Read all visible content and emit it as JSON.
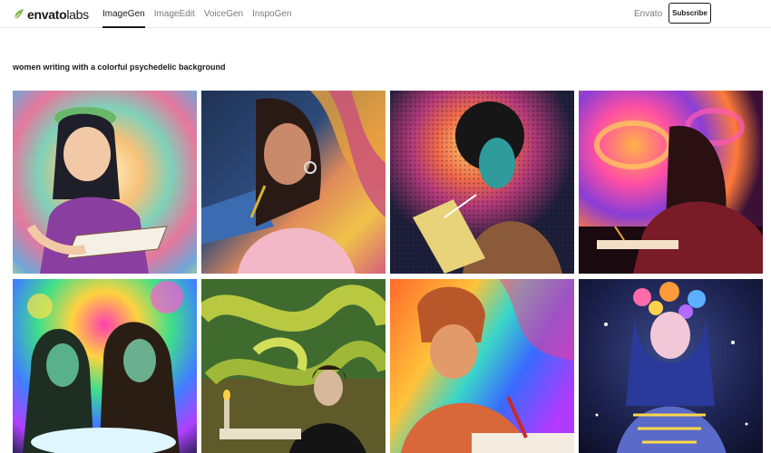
{
  "header": {
    "logo": {
      "icon": "envato-leaf-icon",
      "word_bold": "envato",
      "word_light": "labs",
      "accent": "#82b541"
    },
    "nav": [
      {
        "label": "ImageGen",
        "active": true
      },
      {
        "label": "ImageEdit",
        "active": false
      },
      {
        "label": "VoiceGen",
        "active": false
      },
      {
        "label": "InspoGen",
        "active": false
      }
    ],
    "envato_link": "Envato",
    "subscribe_label": "Subscribe"
  },
  "main": {
    "prompt": "women writing with a colorful psychedelic background",
    "images": [
      {
        "subject": "illustrated woman reading a book, pastel psychedelic rays"
      },
      {
        "subject": "woman in pink shirt holding a pen, swirling stripes"
      },
      {
        "subject": "woman with curly hair writing on a tablet, dotted halo"
      },
      {
        "subject": "woman writing at a desk, red and purple swirls"
      },
      {
        "subject": "two women writing under a glowing light"
      },
      {
        "subject": "woman in black dress writing, green serpent background"
      },
      {
        "subject": "woman writing with red pen, rainbow waves"
      },
      {
        "subject": "woman with flowers in hair, cosmic night background"
      }
    ]
  }
}
